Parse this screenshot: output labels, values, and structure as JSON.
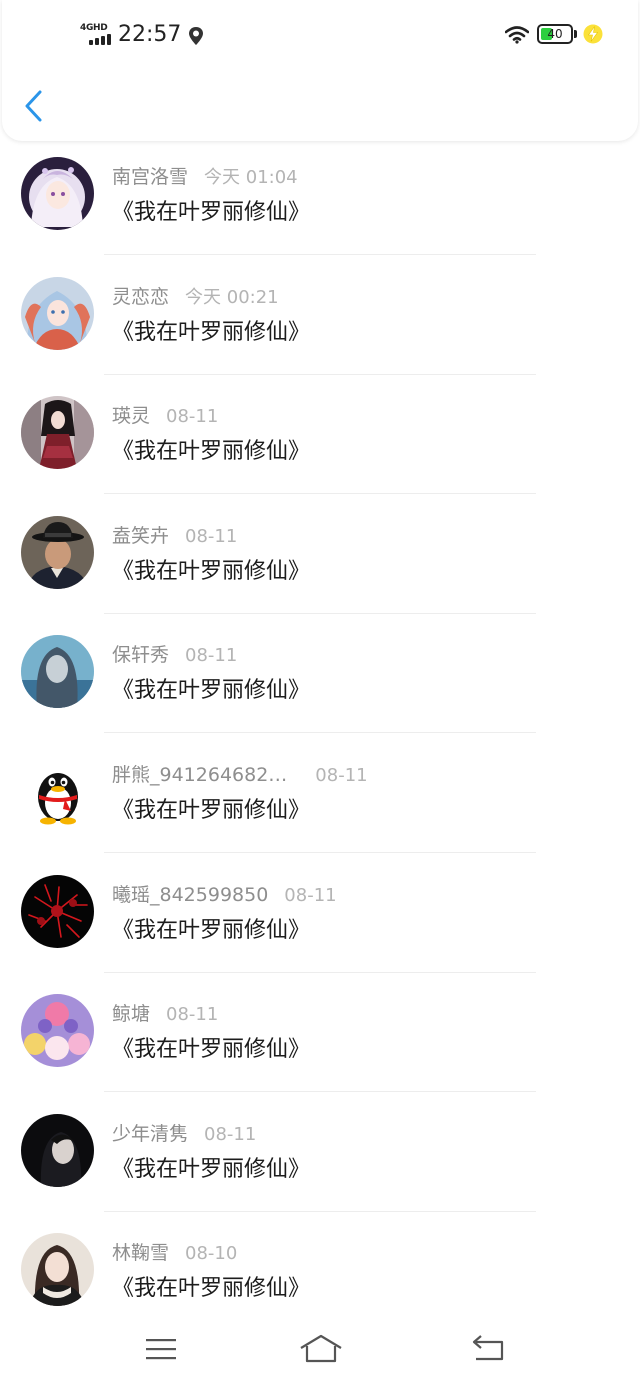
{
  "status_bar": {
    "network": "4GHD",
    "time": "22:57",
    "battery": "40",
    "battery_level": 0.4,
    "icons": [
      "location-icon",
      "wifi-icon",
      "battery-icon",
      "charging-icon"
    ]
  },
  "header": {
    "back_icon": "chevron-left-icon",
    "accent_color": "#2b95e9"
  },
  "comments": [
    {
      "user": "南宫洛雪",
      "time": "今天 01:04",
      "text": "《我在叶罗丽修仙》",
      "avatar": "anime-girl-white-hair"
    },
    {
      "user": "灵恋恋",
      "time": "今天 00:21",
      "text": "《我在叶罗丽修仙》",
      "avatar": "anime-girl-blue-hair"
    },
    {
      "user": "瑛灵",
      "time": "08-11",
      "text": "《我在叶罗丽修仙》",
      "avatar": "doll-red-dress"
    },
    {
      "user": "盍笑卉",
      "time": "08-11",
      "text": "《我在叶罗丽修仙》",
      "avatar": "man-black-hat"
    },
    {
      "user": "保轩秀",
      "time": "08-11",
      "text": "《我在叶罗丽修仙》",
      "avatar": "girl-blue-filter"
    },
    {
      "user": "胖熊_941264682…",
      "time": "08-11",
      "text": "《我在叶罗丽修仙》",
      "avatar": "qq-penguin"
    },
    {
      "user": "曦瑶_842599850",
      "time": "08-11",
      "text": "《我在叶罗丽修仙》",
      "avatar": "red-spider-lily"
    },
    {
      "user": "鲸塘",
      "time": "08-11",
      "text": "《我在叶罗丽修仙》",
      "avatar": "anime-group-purple"
    },
    {
      "user": "少年清隽",
      "time": "08-11",
      "text": "《我在叶罗丽修仙》",
      "avatar": "dark-portrait"
    },
    {
      "user": "林鞠雪",
      "time": "08-10",
      "text": "《我在叶罗丽修仙》",
      "avatar": "girl-scarf"
    }
  ],
  "nav_bar": {
    "icons": [
      "menu-icon",
      "home-icon",
      "back-icon"
    ]
  }
}
